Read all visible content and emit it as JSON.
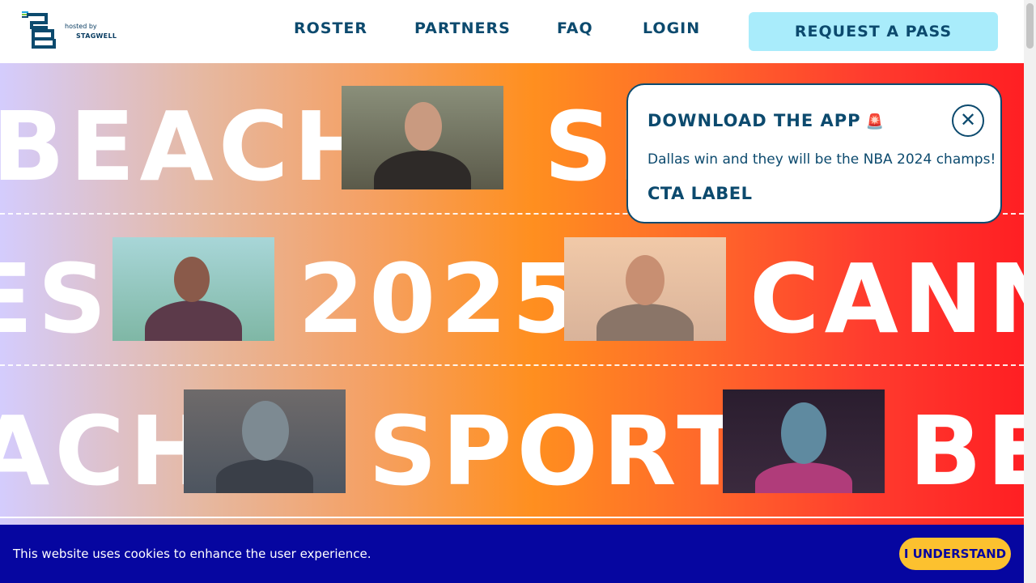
{
  "header": {
    "logo_hosted": "hosted by",
    "logo_brand": "STAGWELL",
    "nav": [
      "ROSTER",
      "PARTNERS",
      "FAQ",
      "LOGIN"
    ],
    "cta": "REQUEST A PASS"
  },
  "hero": {
    "row1": [
      "BEACH",
      "SP"
    ],
    "row2": [
      "ES",
      "2025",
      "CANN"
    ],
    "row3": [
      "ACH",
      "SPORT",
      "BE"
    ]
  },
  "popup": {
    "title": "DOWNLOAD THE APP",
    "icon": "siren-icon",
    "text": "Dallas win and they will be the NBA 2024 champs!",
    "cta": "CTA LABEL",
    "close_icon": "close-icon"
  },
  "cookie": {
    "text": "This website uses cookies to enhance the user experience.",
    "button": "I UNDERSTAND"
  },
  "colors": {
    "brand_navy": "#0c4a6e",
    "cta_bg": "#a9ecfb",
    "cookie_bg": "#0606a0",
    "cookie_btn": "#fcc12f"
  }
}
